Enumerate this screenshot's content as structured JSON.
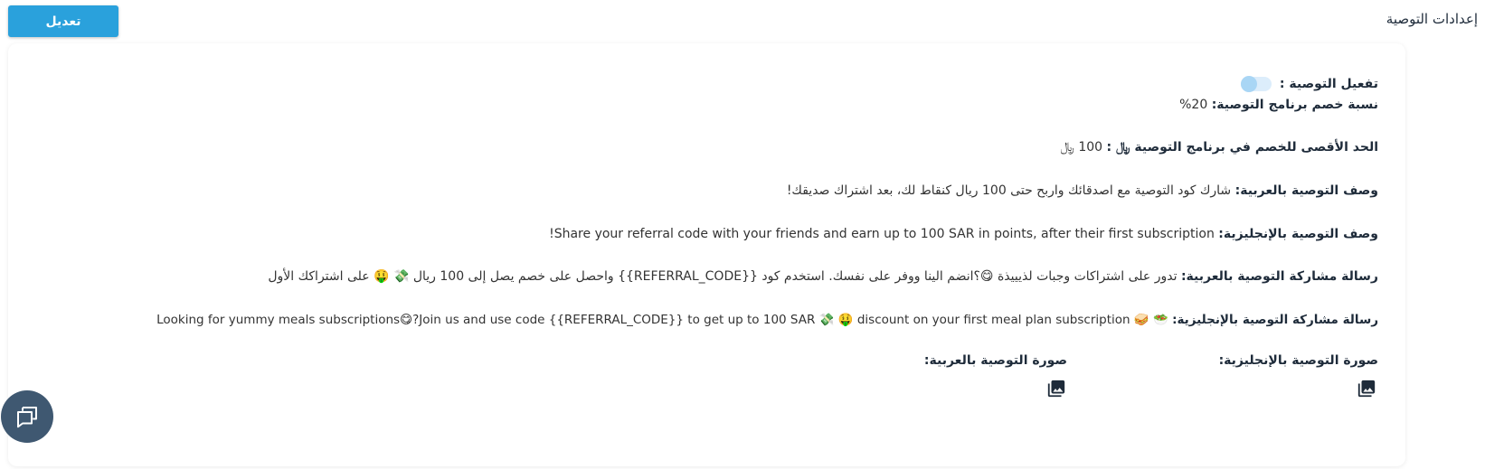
{
  "header": {
    "title": "إعدادات التوصية",
    "edit_label": "تعديل"
  },
  "settings": {
    "activation_label": "تفعيل التوصية :",
    "activation_on": false,
    "discount_label": "نسبة خصم برنامج التوصية:",
    "discount_value": "20%",
    "max_discount_label": "الحد الأقصى للخصم في برنامج التوصية ﷼ :",
    "max_discount_value": "100 ﷼",
    "desc_ar_label": "وصف التوصية بالعربية:",
    "desc_ar_value": "شارك كود التوصية مع اصدقائك واربح حتى 100 ريال كنقاط لك، بعد اشتراك صديقك!",
    "desc_en_label": "وصف التوصية بالإنجليزية:",
    "desc_en_value": "Share your referral code with your friends and earn up to 100 SAR in points, after their first subscription!",
    "share_ar_label": "رسالة مشاركة التوصية بالعربية:",
    "share_ar_value": "تدور على اشتراكات وجبات لذيييذة 😋؟انضم الينا ووفر على نفسك. استخدم كود {{REFERRAL_CODE}} واحصل على خصم يصل إلى 100 ريال 💸 🤑 على اشتراكك الأول",
    "share_en_label": "رسالة مشاركة التوصية بالإنجليزية:",
    "share_en_value": "🥗 🥪 Looking for yummy meals subscriptions😋?Join us and use code {{REFERRAL_CODE}} to get up to 100 SAR 💸 🤑 discount on your first meal plan subscription",
    "img_en_label": "صورة التوصية بالإنجليزية:",
    "img_ar_label": "صورة التوصية بالعربية:"
  },
  "icons": {
    "image": "image-gallery-icon",
    "chat": "chat-icon"
  },
  "colors": {
    "accent": "#2aa1dc",
    "fab": "#3f5871"
  }
}
